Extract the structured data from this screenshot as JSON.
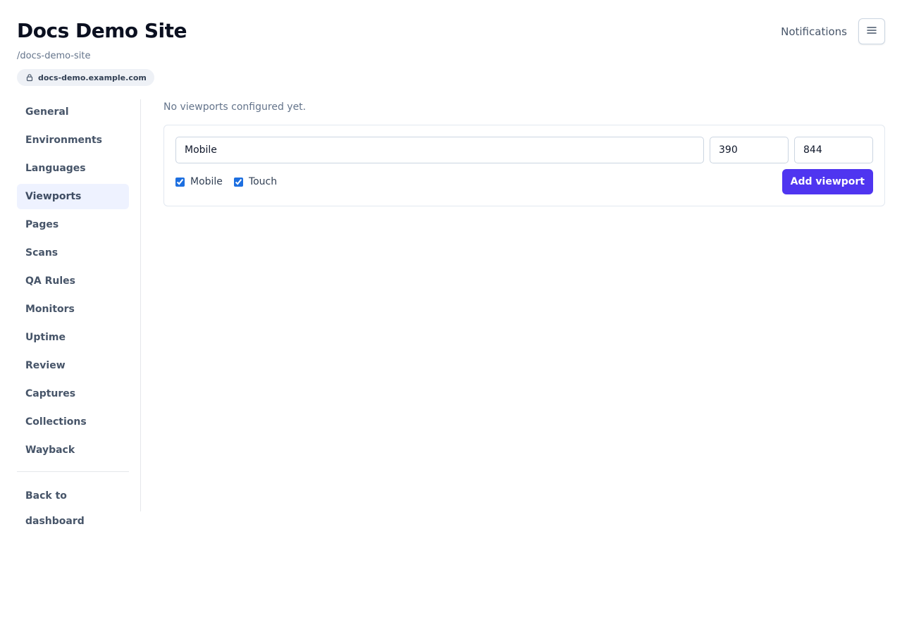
{
  "site": {
    "title": "Docs Demo Site",
    "slug": "/docs-demo-site",
    "domain": "docs-demo.example.com"
  },
  "header": {
    "notifications_label": "Notifications",
    "menu_icon": "hamburger-menu-icon",
    "lock_icon": "lock-icon"
  },
  "sidebar": {
    "items": [
      {
        "label": "General"
      },
      {
        "label": "Environments"
      },
      {
        "label": "Languages"
      },
      {
        "label": "Viewports",
        "active": true
      },
      {
        "label": "Pages"
      },
      {
        "label": "Scans"
      },
      {
        "label": "QA Rules"
      },
      {
        "label": "Monitors"
      },
      {
        "label": "Uptime"
      },
      {
        "label": "Review"
      },
      {
        "label": "Captures"
      },
      {
        "label": "Collections"
      },
      {
        "label": "Wayback"
      }
    ],
    "back_label": "Back to dashboard"
  },
  "main": {
    "empty_message": "No viewports configured yet.",
    "form": {
      "name_value": "Mobile",
      "width_value": "390",
      "height_value": "844",
      "mobile_label": "Mobile",
      "mobile_checked": true,
      "touch_label": "Touch",
      "touch_checked": true,
      "add_button_label": "Add viewport"
    }
  },
  "colors": {
    "accent": "#4f35f0",
    "active_nav_bg": "#eef2ff",
    "checkbox": "#1d6fe0"
  }
}
